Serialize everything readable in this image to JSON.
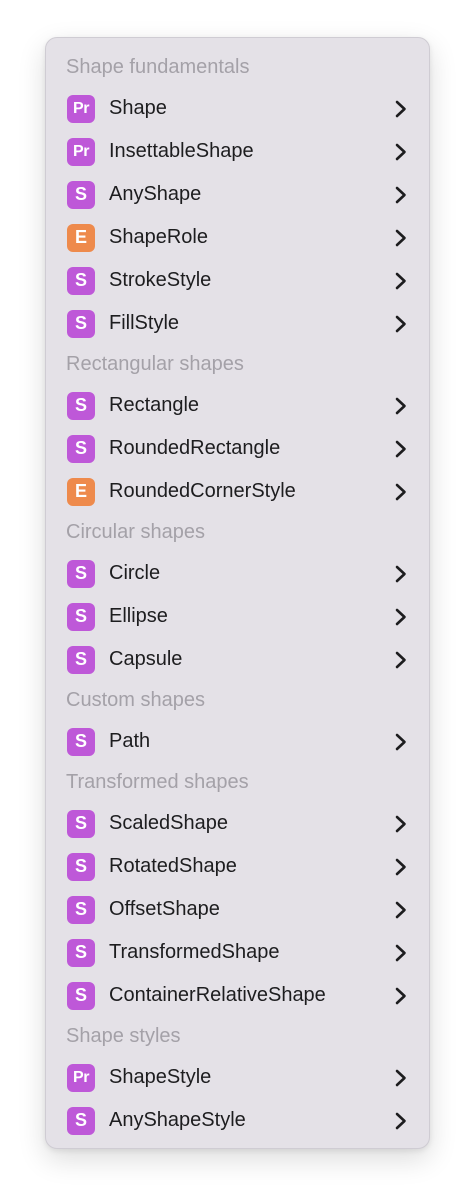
{
  "colors": {
    "structure": "#be58d8",
    "protocol": "#be58d8",
    "enumeration": "#ee8a4c",
    "chevron": "#1d1d1f"
  },
  "sections": [
    {
      "title": "Shape fundamentals",
      "items": [
        {
          "badge": "Pr",
          "kind": "protocol",
          "label": "Shape",
          "icon": "chevron-right-icon"
        },
        {
          "badge": "Pr",
          "kind": "protocol",
          "label": "InsettableShape",
          "icon": "chevron-right-icon"
        },
        {
          "badge": "S",
          "kind": "structure",
          "label": "AnyShape",
          "icon": "chevron-right-icon"
        },
        {
          "badge": "E",
          "kind": "enumeration",
          "label": "ShapeRole",
          "icon": "chevron-right-icon"
        },
        {
          "badge": "S",
          "kind": "structure",
          "label": "StrokeStyle",
          "icon": "chevron-right-icon"
        },
        {
          "badge": "S",
          "kind": "structure",
          "label": "FillStyle",
          "icon": "chevron-right-icon"
        }
      ]
    },
    {
      "title": "Rectangular shapes",
      "items": [
        {
          "badge": "S",
          "kind": "structure",
          "label": "Rectangle",
          "icon": "chevron-right-icon"
        },
        {
          "badge": "S",
          "kind": "structure",
          "label": "RoundedRectangle",
          "icon": "chevron-right-icon"
        },
        {
          "badge": "E",
          "kind": "enumeration",
          "label": "RoundedCornerStyle",
          "icon": "chevron-right-icon"
        }
      ]
    },
    {
      "title": "Circular shapes",
      "items": [
        {
          "badge": "S",
          "kind": "structure",
          "label": "Circle",
          "icon": "chevron-right-icon"
        },
        {
          "badge": "S",
          "kind": "structure",
          "label": "Ellipse",
          "icon": "chevron-right-icon"
        },
        {
          "badge": "S",
          "kind": "structure",
          "label": "Capsule",
          "icon": "chevron-right-icon"
        }
      ]
    },
    {
      "title": "Custom shapes",
      "items": [
        {
          "badge": "S",
          "kind": "structure",
          "label": "Path",
          "icon": "chevron-right-icon"
        }
      ]
    },
    {
      "title": "Transformed shapes",
      "items": [
        {
          "badge": "S",
          "kind": "structure",
          "label": "ScaledShape",
          "icon": "chevron-right-icon"
        },
        {
          "badge": "S",
          "kind": "structure",
          "label": "RotatedShape",
          "icon": "chevron-right-icon"
        },
        {
          "badge": "S",
          "kind": "structure",
          "label": "OffsetShape",
          "icon": "chevron-right-icon"
        },
        {
          "badge": "S",
          "kind": "structure",
          "label": "TransformedShape",
          "icon": "chevron-right-icon"
        },
        {
          "badge": "S",
          "kind": "structure",
          "label": "ContainerRelativeShape",
          "icon": "chevron-right-icon"
        }
      ]
    },
    {
      "title": "Shape styles",
      "items": [
        {
          "badge": "Pr",
          "kind": "protocol",
          "label": "ShapeStyle",
          "icon": "chevron-right-icon"
        },
        {
          "badge": "S",
          "kind": "structure",
          "label": "AnyShapeStyle",
          "icon": "chevron-right-icon"
        }
      ]
    }
  ]
}
